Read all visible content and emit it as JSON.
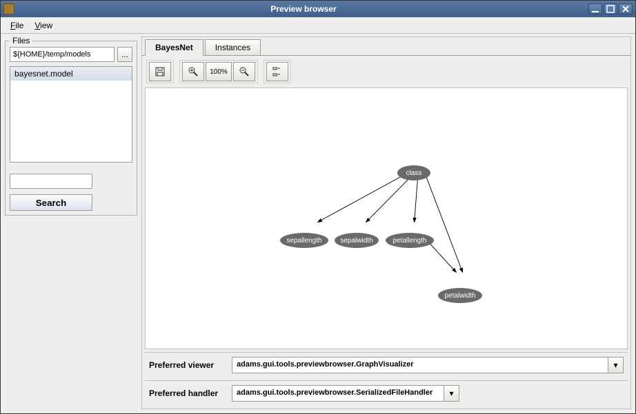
{
  "window": {
    "title": "Preview browser"
  },
  "menubar": {
    "file": "File",
    "view": "View"
  },
  "files": {
    "legend": "Files",
    "path": "${HOME}/temp/models",
    "browse_label": "...",
    "items": [
      "bayesnet.model"
    ],
    "search_label": "Search"
  },
  "tabs": {
    "bayesnet": "BayesNet",
    "instances": "Instances"
  },
  "toolbar": {
    "zoom_label": "100%"
  },
  "graph": {
    "nodes": {
      "class": "class",
      "sepallength": "sepallength",
      "sepalwidth": "sepalwidth",
      "petallength": "petallength",
      "petalwidth": "petalwidth"
    }
  },
  "prefs": {
    "viewer_label": "Preferred viewer",
    "viewer_value": "adams.gui.tools.previewbrowser.GraphVisualizer",
    "handler_label": "Preferred handler",
    "handler_value": "adams.gui.tools.previewbrowser.SerializedFileHandler"
  }
}
